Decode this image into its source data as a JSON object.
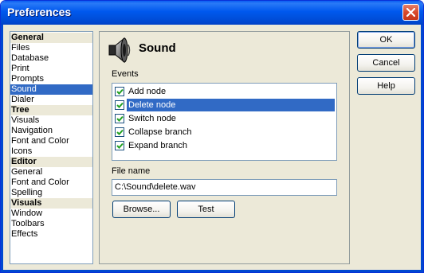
{
  "window": {
    "title": "Preferences"
  },
  "categories": [
    {
      "label": "General",
      "type": "header"
    },
    {
      "label": "Files",
      "type": "item"
    },
    {
      "label": "Database",
      "type": "item"
    },
    {
      "label": "Print",
      "type": "item"
    },
    {
      "label": "Prompts",
      "type": "item"
    },
    {
      "label": "Sound",
      "type": "item",
      "selected": true
    },
    {
      "label": "Dialer",
      "type": "item"
    },
    {
      "label": "Tree",
      "type": "header"
    },
    {
      "label": "Visuals",
      "type": "item"
    },
    {
      "label": "Navigation",
      "type": "item"
    },
    {
      "label": "Font and Color",
      "type": "item"
    },
    {
      "label": "Icons",
      "type": "item"
    },
    {
      "label": "Editor",
      "type": "header"
    },
    {
      "label": "General",
      "type": "item"
    },
    {
      "label": "Font and Color",
      "type": "item"
    },
    {
      "label": "Spelling",
      "type": "item"
    },
    {
      "label": "Visuals",
      "type": "header"
    },
    {
      "label": "Window",
      "type": "item"
    },
    {
      "label": "Toolbars",
      "type": "item"
    },
    {
      "label": "Effects",
      "type": "item"
    }
  ],
  "panel": {
    "title": "Sound",
    "icon": "speaker-icon",
    "events_label": "Events",
    "events": [
      {
        "label": "Add node",
        "checked": true,
        "selected": false
      },
      {
        "label": "Delete node",
        "checked": true,
        "selected": true
      },
      {
        "label": "Switch node",
        "checked": true,
        "selected": false
      },
      {
        "label": "Collapse branch",
        "checked": true,
        "selected": false
      },
      {
        "label": "Expand branch",
        "checked": true,
        "selected": false
      }
    ],
    "file_label": "File name",
    "file_value": "C:\\Sound\\delete.wav",
    "browse_label": "Browse...",
    "test_label": "Test"
  },
  "buttons": {
    "ok": "OK",
    "cancel": "Cancel",
    "help": "Help"
  },
  "colors": {
    "selection": "#316ac5",
    "titlebar": "#0054e3",
    "dialog_bg": "#ece9d8"
  }
}
